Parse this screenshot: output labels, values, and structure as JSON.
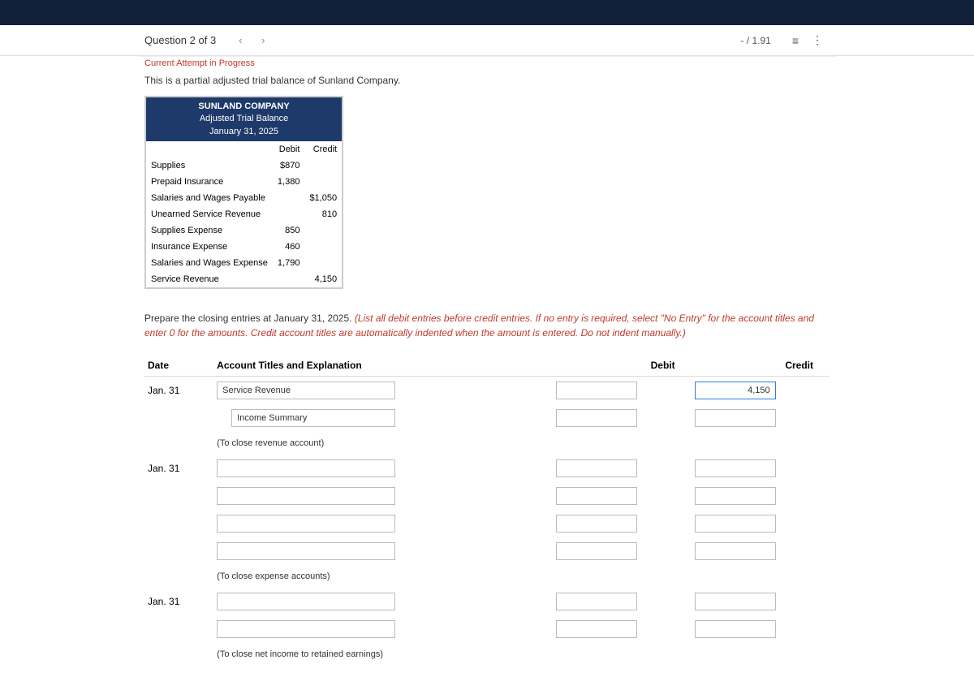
{
  "header": {
    "question_label": "Question 2 of 3",
    "prev_icon": "‹",
    "next_icon": "›",
    "score": "- / 1.91",
    "list_icon": "≡",
    "more_icon": "⋮"
  },
  "attempt_status": "Current Attempt in Progress",
  "intro": "This is a partial adjusted trial balance of Sunland Company.",
  "trial_balance": {
    "company": "SUNLAND COMPANY",
    "title": "Adjusted Trial Balance",
    "date": "January 31, 2025",
    "col_debit": "Debit",
    "col_credit": "Credit",
    "rows": [
      {
        "account": "Supplies",
        "debit": "$870",
        "credit": ""
      },
      {
        "account": "Prepaid Insurance",
        "debit": "1,380",
        "credit": ""
      },
      {
        "account": "Salaries and Wages Payable",
        "debit": "",
        "credit": "$1,050"
      },
      {
        "account": "Unearned Service Revenue",
        "debit": "",
        "credit": "810"
      },
      {
        "account": "Supplies Expense",
        "debit": "850",
        "credit": ""
      },
      {
        "account": "Insurance Expense",
        "debit": "460",
        "credit": ""
      },
      {
        "account": "Salaries and Wages Expense",
        "debit": "1,790",
        "credit": ""
      },
      {
        "account": "Service Revenue",
        "debit": "",
        "credit": "4,150"
      }
    ]
  },
  "instructions": {
    "black": "Prepare the closing entries at January 31, 2025. ",
    "red": "(List all debit entries before credit entries. If no entry is required, select \"No Entry\" for the account titles and enter 0 for the amounts. Credit account titles are automatically indented when the amount is entered. Do not indent manually.)"
  },
  "entry_headers": {
    "date": "Date",
    "account": "Account Titles and Explanation",
    "debit": "Debit",
    "credit": "Credit"
  },
  "entries": {
    "date1": "Jan. 31",
    "acct1": "Service Revenue",
    "credit1": "4,150",
    "acct2": "Income Summary",
    "note1": "(To close revenue account)",
    "date2": "Jan. 31",
    "note2": "(To close expense accounts)",
    "date3": "Jan. 31",
    "note3": "(To close net income to retained earnings)"
  }
}
